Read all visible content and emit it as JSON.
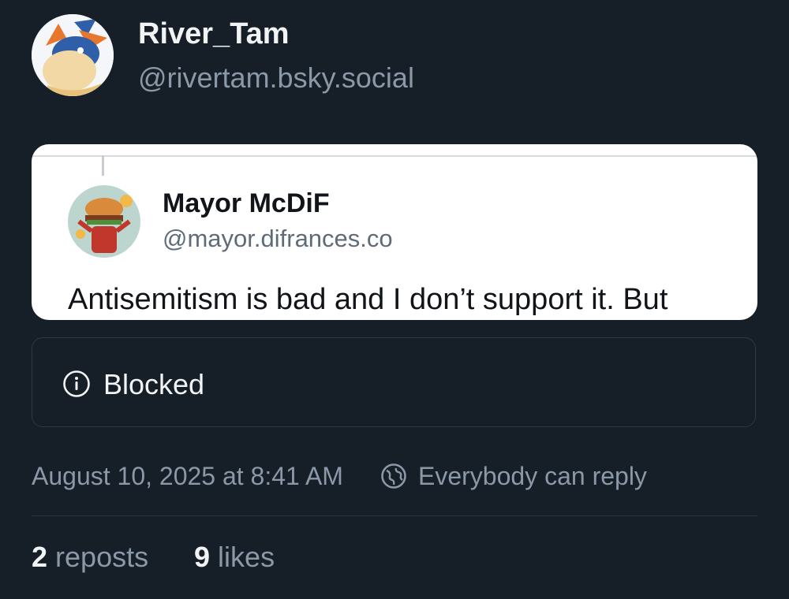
{
  "author": {
    "name": "River_Tam",
    "handle": "@rivertam.bsky.social"
  },
  "embed": {
    "name": "Mayor McDiF",
    "handle": "@mayor.difrances.co",
    "text": "Antisemitism is bad and I don’t support it. But"
  },
  "quote": {
    "status_label": "Blocked",
    "icon": "info-icon"
  },
  "meta": {
    "timestamp": "August 10, 2025 at 8:41 AM",
    "reply_setting": "Everybody can reply",
    "reply_icon": "globe-icon"
  },
  "stats": {
    "reposts_count": "2",
    "reposts_label": "reposts",
    "likes_count": "9",
    "likes_label": "likes"
  },
  "colors": {
    "background": "#161e27",
    "text_primary": "#f1f3f5",
    "text_secondary": "#8b98a8",
    "border": "#2f3a47"
  }
}
